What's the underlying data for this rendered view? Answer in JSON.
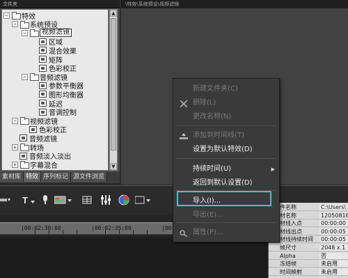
{
  "left_panel": {
    "header": "文件夹",
    "tree": [
      {
        "label": "特效",
        "level": 0,
        "expander": "−",
        "icon": "folder"
      },
      {
        "label": "系统预设",
        "level": 1,
        "expander": "−",
        "icon": "folder"
      },
      {
        "label": "视频滤镜",
        "level": 2,
        "expander": "−",
        "icon": "folder",
        "selected": true
      },
      {
        "label": "区域",
        "level": 3,
        "icon": "film"
      },
      {
        "label": "混合效果",
        "level": 3,
        "icon": "film"
      },
      {
        "label": "矩阵",
        "level": 3,
        "icon": "film"
      },
      {
        "label": "色彩校正",
        "level": 3,
        "icon": "film"
      },
      {
        "label": "音频滤镜",
        "level": 2,
        "expander": "−",
        "icon": "folder"
      },
      {
        "label": "参数平衡器",
        "level": 3,
        "icon": "film"
      },
      {
        "label": "图形均衡器",
        "level": 3,
        "icon": "film"
      },
      {
        "label": "延迟",
        "level": 3,
        "icon": "film"
      },
      {
        "label": "音调控制",
        "level": 3,
        "icon": "film"
      },
      {
        "label": "视频滤镜",
        "level": 1,
        "expander": "−",
        "icon": "folder"
      },
      {
        "label": "色彩校正",
        "level": 2,
        "icon": "film"
      },
      {
        "label": "音频滤镜",
        "level": 1,
        "icon": "film"
      },
      {
        "label": "转场",
        "level": 1,
        "expander": "+",
        "icon": "folder"
      },
      {
        "label": "音频淡入淡出",
        "level": 1,
        "icon": "film"
      },
      {
        "label": "字幕混合",
        "level": 1,
        "expander": "+",
        "icon": "folder"
      }
    ],
    "tabs": [
      "素材库",
      "特效",
      "序列标记",
      "源文件浏览"
    ]
  },
  "preview": {
    "breadcrumb": "\\特效\\系统预设\\视频滤镜"
  },
  "toolbar": {
    "icons": [
      "cut-icon",
      "title-icon",
      "microphone-icon",
      "track-icon",
      "grid-icon",
      "mixer-icon",
      "color-wheel-icon",
      "display-icon"
    ]
  },
  "timeline": {
    "timecodes": [
      "|00:02:30:00",
      "|00:02:35:00",
      "|00:02:40:00"
    ]
  },
  "properties": {
    "rows": [
      {
        "key": "件名称",
        "value": "C:\\Users\\"
      },
      {
        "key": "材名称",
        "value": "12050816"
      },
      {
        "key": "材线入点",
        "value": "00:00:00"
      },
      {
        "key": "材线出点",
        "value": "00:00:05"
      },
      {
        "key": "材线持续时间",
        "value": "00:00:05"
      },
      {
        "key": "帧尺寸",
        "value": "2048 x 1"
      },
      {
        "key": "Alpha",
        "value": "否"
      },
      {
        "key": "冻结帧",
        "value": "未启用"
      },
      {
        "key": "时间映射",
        "value": "未启用"
      }
    ]
  },
  "context_menu": {
    "items": [
      {
        "label": "新建文件夹(C)",
        "enabled": false,
        "icon": ""
      },
      {
        "label": "删除(L)",
        "enabled": false,
        "icon": "delete-icon"
      },
      {
        "label": "更改名称(N)",
        "enabled": false,
        "icon": ""
      },
      {
        "label": "添加到时间线(T)",
        "enabled": false,
        "icon": "add-to-timeline-icon"
      },
      {
        "label": "设置为默认特效(D)",
        "enabled": true,
        "icon": ""
      },
      {
        "label": "持续时间(U)",
        "enabled": true,
        "icon": "",
        "submenu": true
      },
      {
        "label": "返回到默认设置(D)",
        "enabled": true,
        "icon": ""
      },
      {
        "label": "导入(I)...",
        "enabled": true,
        "icon": "",
        "highlighted": true
      },
      {
        "label": "导出(E)...",
        "enabled": false,
        "icon": ""
      },
      {
        "label": "属性(P)...",
        "enabled": false,
        "icon": "properties-icon"
      }
    ],
    "highlight_color": "#3ec7d1"
  }
}
